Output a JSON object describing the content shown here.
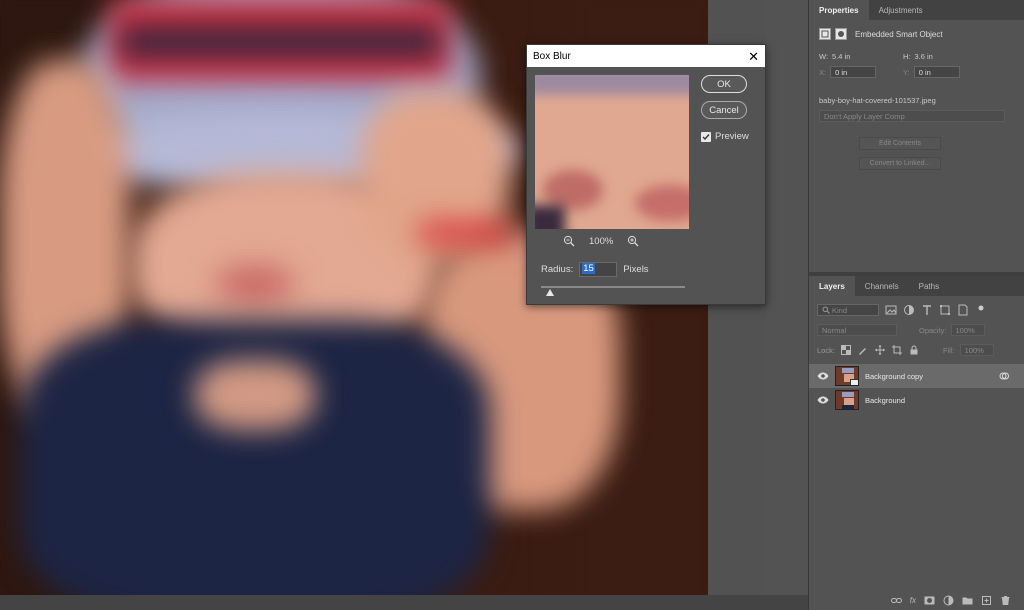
{
  "dialog": {
    "title": "Box Blur",
    "ok_label": "OK",
    "cancel_label": "Cancel",
    "preview_label": "Preview",
    "preview_checked": true,
    "zoom_level": "100%",
    "radius_label": "Radius:",
    "radius_value": "15",
    "radius_unit": "Pixels",
    "radius_fraction": 0.06
  },
  "properties_panel": {
    "tabs": [
      "Properties",
      "Adjustments"
    ],
    "object_type": "Embedded Smart Object",
    "width_label": "W:",
    "width_value": "5.4 in",
    "height_label": "H:",
    "height_value": "3.6 in",
    "x_label": "X:",
    "x_value": "0 in",
    "y_label": "Y:",
    "y_value": "0 in",
    "filename": "baby-boy-hat-covered-101537.jpeg",
    "layer_comp_placeholder": "Don't Apply Layer Comp",
    "edit_contents_label": "Edit Contents",
    "convert_label": "Convert to Linked..."
  },
  "layers_panel": {
    "tabs": [
      "Layers",
      "Channels",
      "Paths"
    ],
    "search_placeholder": "Kind",
    "blend_mode": "Normal",
    "opacity_label": "Opacity:",
    "opacity_value": "100%",
    "lock_label": "Lock:",
    "fill_label": "Fill:",
    "fill_value": "100%",
    "layers": [
      {
        "name": "Background copy",
        "selected": true
      },
      {
        "name": "Background",
        "selected": false
      }
    ],
    "footer_fx": "fx"
  }
}
